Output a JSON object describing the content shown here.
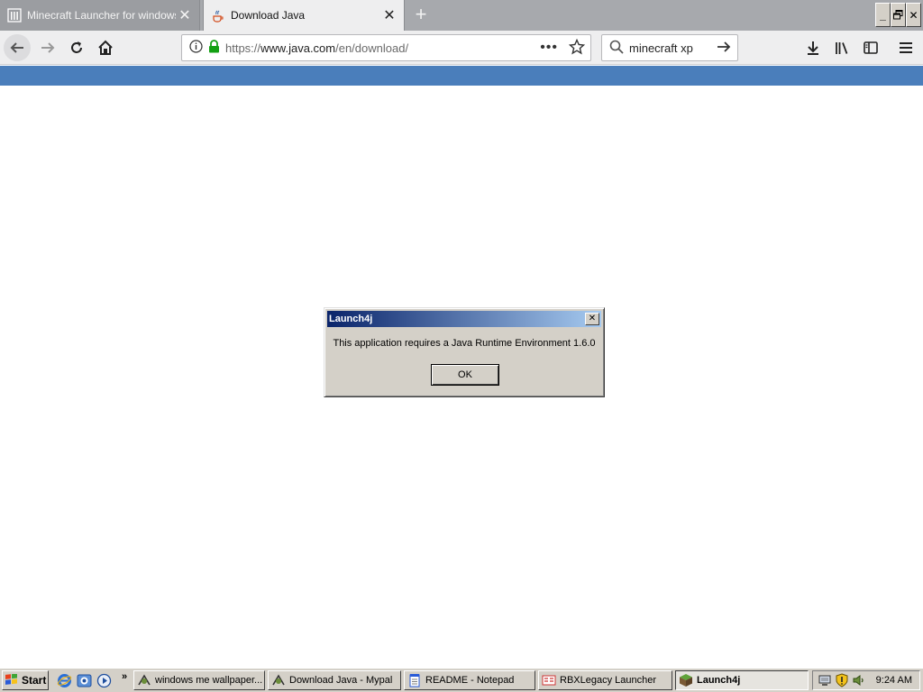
{
  "browser": {
    "tabs": [
      {
        "title": "Minecraft Launcher for windows xp",
        "icon": "library-columns-icon",
        "active": false
      },
      {
        "title": "Download Java",
        "icon": "java-cup-icon",
        "active": true
      }
    ],
    "new_tab_icon": "plus-icon",
    "url": {
      "scheme": "https://",
      "host": "www.java.com",
      "path": "/en/download/"
    },
    "search": {
      "value": "minecraft xp"
    },
    "page_accent_color": "#4a7ebb"
  },
  "window_controls": {
    "minimize": "_",
    "restore": "🗗",
    "close": "✕"
  },
  "dialog": {
    "title": "Launch4j",
    "message": "This application requires a Java Runtime Environment 1.6.0",
    "ok_label": "OK",
    "close_glyph": "✕"
  },
  "taskbar": {
    "start_label": "Start",
    "quick_launch_chevron": "»",
    "buttons": [
      {
        "label": "windows me wallpaper...",
        "icon": "browser-icon",
        "pressed": false
      },
      {
        "label": "Download Java - Mypal",
        "icon": "browser-icon",
        "pressed": false
      },
      {
        "label": "README - Notepad",
        "icon": "notepad-icon",
        "pressed": false
      },
      {
        "label": "RBXLegacy Launcher",
        "icon": "rbxlegacy-icon",
        "pressed": false
      },
      {
        "label": "Launch4j",
        "icon": "minecraft-block-icon",
        "pressed": true
      }
    ],
    "clock": "9:24 AM"
  }
}
